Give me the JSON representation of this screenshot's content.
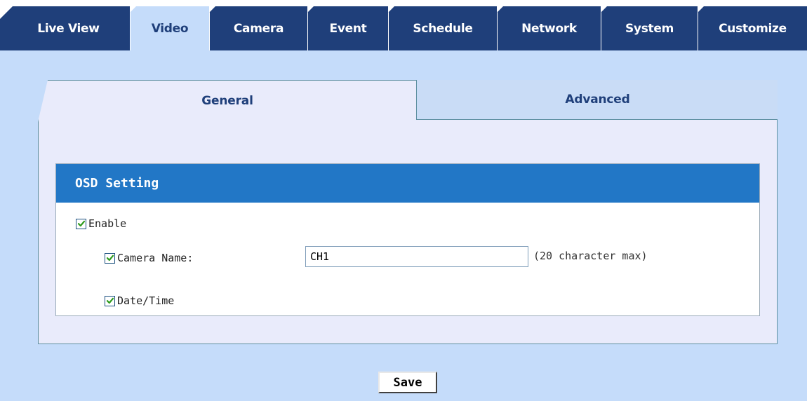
{
  "top_nav": {
    "tabs": [
      {
        "label": "Live View",
        "active": false
      },
      {
        "label": "Video",
        "active": true
      },
      {
        "label": "Camera",
        "active": false
      },
      {
        "label": "Event",
        "active": false
      },
      {
        "label": "Schedule",
        "active": false
      },
      {
        "label": "Network",
        "active": false
      },
      {
        "label": "System",
        "active": false
      },
      {
        "label": "Customize",
        "active": false
      }
    ]
  },
  "sub_tabs": {
    "general": "General",
    "advanced": "Advanced",
    "active": "General"
  },
  "osd": {
    "title": "OSD Setting",
    "enable": {
      "label": "Enable",
      "checked": true
    },
    "camera_name": {
      "label": "Camera Name:",
      "checked": true,
      "value": "CH1",
      "hint": "(20 character max)"
    },
    "date_time": {
      "label": "Date/Time",
      "checked": true
    }
  },
  "actions": {
    "save_label": "Save"
  },
  "colors": {
    "nav_background": "#1f3f7a",
    "page_background": "#c5dcfa",
    "panel_background": "#e9ebfb",
    "header_background": "#2277c6",
    "checkmark": "#2e9b1c"
  }
}
